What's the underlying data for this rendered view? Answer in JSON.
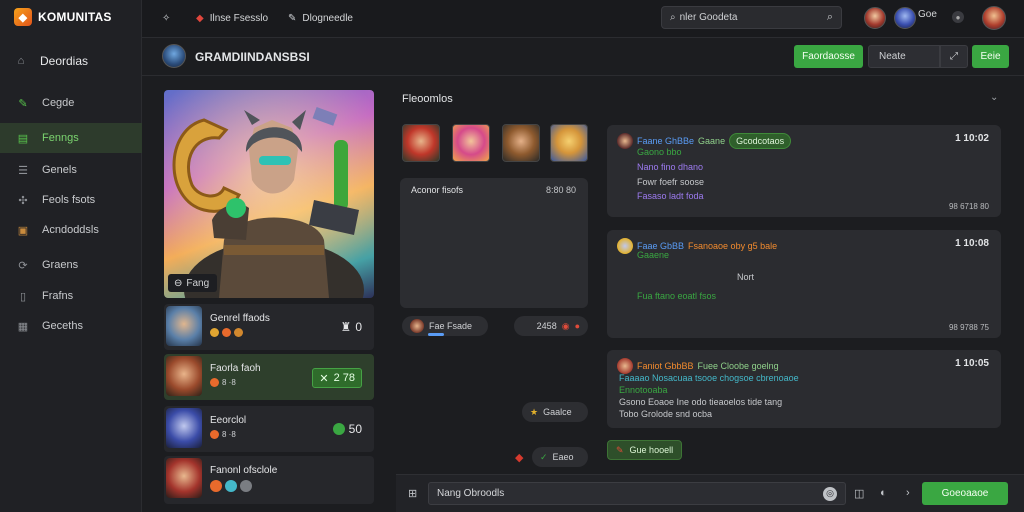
{
  "brand": {
    "name": "KOMUNITAS",
    "logo_icon": "ember-logo-icon"
  },
  "sidebar": {
    "home": {
      "label": "Deordias",
      "icon": "home-icon"
    },
    "items": [
      {
        "label": "Cegde",
        "icon": "pen-icon"
      },
      {
        "label": "Fenngs",
        "icon": "chat-icon",
        "active": true
      },
      {
        "label": "Genels",
        "icon": "list-icon"
      },
      {
        "label": "Feols fsots",
        "icon": "puzzle-icon"
      },
      {
        "label": "Acndoddsls",
        "icon": "box-icon"
      },
      {
        "label": "Graens",
        "icon": "refresh-icon"
      },
      {
        "label": "Frafns",
        "icon": "bookmark-icon"
      },
      {
        "label": "Geceths",
        "icon": "grid-icon"
      }
    ]
  },
  "topbar": {
    "nav": [
      {
        "label": "",
        "icon": "settings-icon"
      },
      {
        "label": "Ilnse Fsesslo",
        "icon": "flag-icon"
      },
      {
        "label": "Dlogneedle",
        "icon": "edit-icon"
      }
    ],
    "search": {
      "value": "nler Goodeta",
      "icon": "search-icon"
    },
    "user_name": "Goe"
  },
  "channel": {
    "title": "GRAMDIINDANSBSI",
    "actions": {
      "primary": "Faordaosse",
      "secondary": "Neate",
      "tertiary": "Eeie"
    }
  },
  "hero": {
    "badge": "Fang"
  },
  "players": [
    {
      "name": "Genrel ffaods",
      "score": "0",
      "style": "plain"
    },
    {
      "name": "Faorla faoh",
      "badges": "8 ·8",
      "score": "2 78",
      "style": "pill",
      "highlight": true
    },
    {
      "name": "Eeorclol",
      "badges": "8 ·8",
      "score": "50",
      "style": "dot"
    },
    {
      "name": "Fanonl ofsclole",
      "score": "",
      "style": "none"
    }
  ],
  "feed": {
    "title": "Fleoomlos",
    "card": {
      "title": "Aconor fisofs",
      "time": "8:80 80"
    },
    "pill_user": "Fae Fsade",
    "pill_reaction": "2458",
    "pill_small": "Gaalce",
    "pill_small2": "Eaeo"
  },
  "messages": [
    {
      "author": "Faane GhBBe",
      "tag": "Gaane",
      "chip": "Gcodcotaos",
      "time": "1 10:02",
      "lines": [
        "Gaono bbo",
        "Nano fino dhano",
        "Fowr foefr soose",
        "Fasaso ladt foda"
      ],
      "foot": "98 6718 80"
    },
    {
      "author": "Faae GbBB",
      "tag": "Fsanoaoe oby g5 bale",
      "time": "1 10:08",
      "lines": [
        "Gaaene",
        "Nort",
        "Fua ftano eoatl fsos"
      ],
      "foot": "98 9788 75"
    },
    {
      "author": "Faniot GbbBB",
      "tag": "Fuee Cloobe goelng",
      "time": "1 10:05",
      "lines": [
        "Faaaao Nosacuaa tsooe chogsoe cbrenoaoe",
        "Ennotooaba",
        "Gsono Eoaoe Ine odo tieaoelos tide tang",
        "Tobo Grolode snd ocba"
      ],
      "foot": ""
    }
  ],
  "ping": {
    "label": "Gue hooell"
  },
  "composer": {
    "value": "Nang Obroodls",
    "send": "Goeoaaoe"
  },
  "colors": {
    "accent": "#3aa742",
    "bg": "#1c1d20",
    "card": "#2b2c30",
    "blue": "#5a9cf5",
    "orange": "#f28b2e",
    "purple": "#9d7bf0",
    "teal": "#44b8c9"
  }
}
